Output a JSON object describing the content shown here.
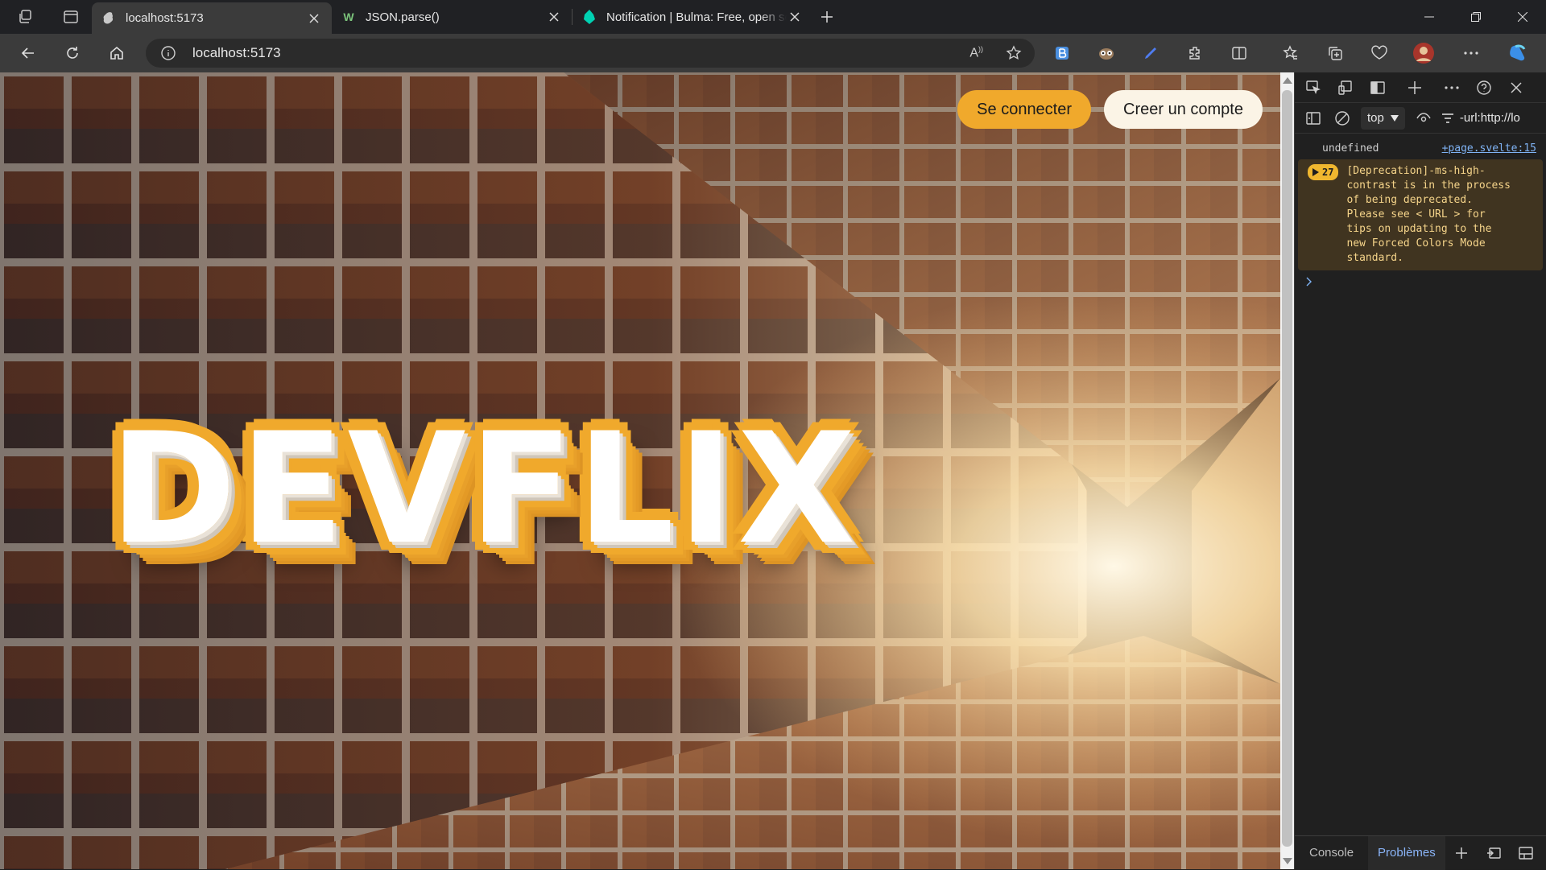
{
  "browser": {
    "tabs": [
      {
        "title": "localhost:5173",
        "active": true
      },
      {
        "title": "JSON.parse()",
        "active": false
      },
      {
        "title": "Notification | Bulma: Free, open source",
        "active": false
      }
    ],
    "address": "localhost:5173"
  },
  "page": {
    "login_label": "Se connecter",
    "signup_label": "Creer un compte",
    "logo": "DEVFLIX",
    "colors": {
      "accent": "#f0a92c",
      "signup_bg": "#fbf4e6"
    }
  },
  "devtools": {
    "context": "top",
    "filter": "-url:http://lo",
    "logs": [
      {
        "text": "undefined",
        "source": "+page.svelte:15"
      }
    ],
    "warning": {
      "count": "27",
      "message": "[Deprecation]-ms-high-contrast is in the process of being deprecated. Please see < URL > for tips on updating to the new Forced Colors Mode standard."
    },
    "footer": {
      "console": "Console",
      "problems": "Problèmes"
    }
  }
}
